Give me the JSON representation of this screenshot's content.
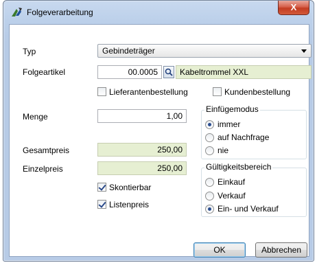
{
  "window": {
    "title": "Folgeverarbeitung",
    "close_label": "X"
  },
  "form": {
    "typ_label": "Typ",
    "typ_value": "Gebindeträger",
    "folgeartikel_label": "Folgeartikel",
    "folgeartikel_number": "00.0005",
    "folgeartikel_name": "Kabeltrommel XXL",
    "lieferantenbestellung_label": "Lieferantenbestellung",
    "lieferantenbestellung_checked": false,
    "kundenbestellung_label": "Kundenbestellung",
    "kundenbestellung_checked": false,
    "menge_label": "Menge",
    "menge_value": "1,00",
    "gesamtpreis_label": "Gesamtpreis",
    "gesamtpreis_value": "250,00",
    "einzelpreis_label": "Einzelpreis",
    "einzelpreis_value": "250,00",
    "skontierbar_label": "Skontierbar",
    "skontierbar_checked": true,
    "listenpreis_label": "Listenpreis",
    "listenpreis_checked": true
  },
  "einfuegemodus": {
    "title": "Einfügemodus",
    "options": [
      "immer",
      "auf Nachfrage",
      "nie"
    ],
    "selected": "immer"
  },
  "gueltigkeitsbereich": {
    "title": "Gültigkeitsbereich",
    "options": [
      "Einkauf",
      "Verkauf",
      "Ein- und Verkauf"
    ],
    "selected": "Ein- und Verkauf"
  },
  "buttons": {
    "ok_label": "OK",
    "cancel_label": "Abbrechen"
  },
  "colors": {
    "readonly_field_bg": "#e6efd2",
    "window_frame": "#bcd0ea",
    "close_button": "#c23c22"
  }
}
